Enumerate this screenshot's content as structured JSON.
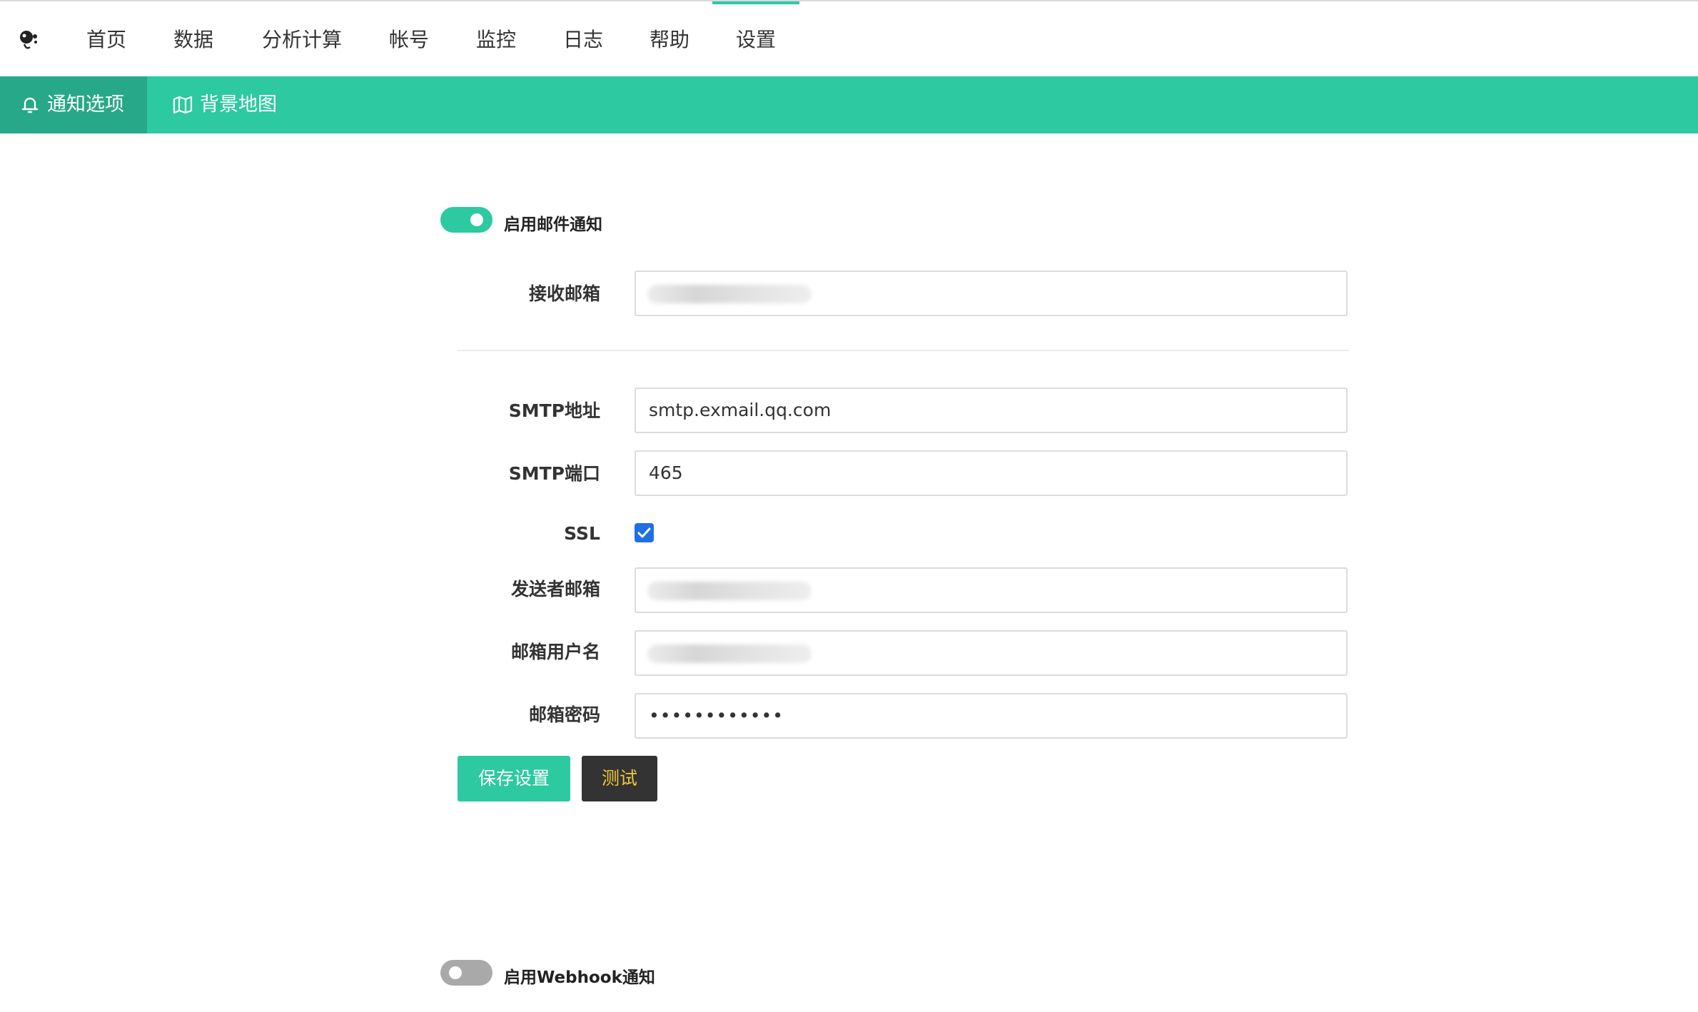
{
  "nav": {
    "items": [
      {
        "label": "首页"
      },
      {
        "label": "数据"
      },
      {
        "label": "分析计算"
      },
      {
        "label": "帐号"
      },
      {
        "label": "监控"
      },
      {
        "label": "日志"
      },
      {
        "label": "帮助"
      },
      {
        "label": "设置",
        "active": true
      }
    ]
  },
  "subnav": {
    "tabs": [
      {
        "label": "通知选项",
        "icon": "bell-icon",
        "active": true
      },
      {
        "label": "背景地图",
        "icon": "map-icon"
      }
    ]
  },
  "email_notify": {
    "toggle_on": true,
    "label": "启用邮件通知",
    "recipient_label": "接收邮箱",
    "smtp_host_label": "SMTP地址",
    "smtp_host_value": "smtp.exmail.qq.com",
    "smtp_port_label": "SMTP端口",
    "smtp_port_value": "465",
    "ssl_label": "SSL",
    "ssl_checked": true,
    "sender_label": "发送者邮箱",
    "username_label": "邮箱用户名",
    "password_label": "邮箱密码",
    "password_value": "••••••••••••",
    "save_button": "保存设置",
    "test_button": "测试"
  },
  "webhook_notify": {
    "toggle_on": false,
    "label": "启用Webhook通知"
  },
  "colors": {
    "accent": "#2dc9a1",
    "accent_dark": "#27a888",
    "test_button_bg": "#333333",
    "test_button_text": "#f3c73f",
    "checkbox": "#1f6fe5"
  }
}
